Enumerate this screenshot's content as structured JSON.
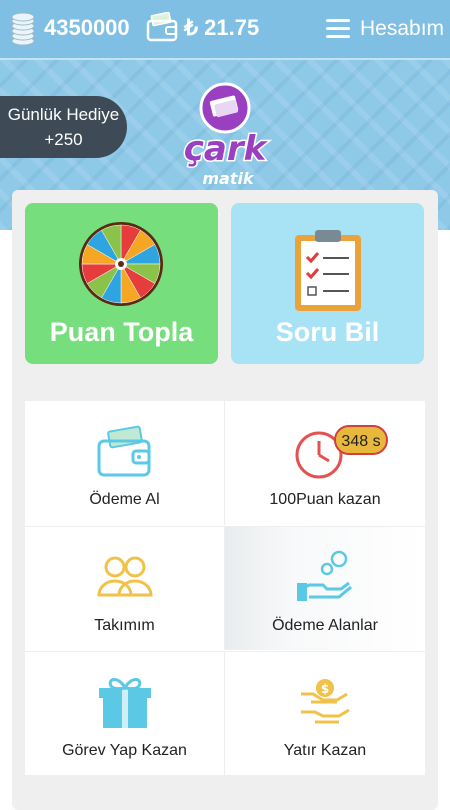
{
  "topbar": {
    "points": "4350000",
    "currency_symbol": "₺",
    "balance": "21.75",
    "menu_label": "Hesabım"
  },
  "daily_gift": {
    "label": "Günlük Hediye",
    "amount": "+250"
  },
  "logo": {
    "brand": "çark",
    "sub": "matik"
  },
  "main_tiles": [
    {
      "label": "Puan Topla",
      "icon": "prize-wheel-icon"
    },
    {
      "label": "Soru Bil",
      "icon": "checklist-clipboard-icon"
    }
  ],
  "menu_grid": [
    {
      "label": "Ödeme Al",
      "icon": "wallet-icon"
    },
    {
      "label": "100Puan kazan",
      "icon": "clock-icon",
      "badge": "348 s"
    },
    {
      "label": "Takımım",
      "icon": "team-icon"
    },
    {
      "label": "Ödeme Alanlar",
      "icon": "hand-coins-icon"
    },
    {
      "label": "Görev Yap Kazan",
      "icon": "gift-icon"
    },
    {
      "label": "Yatır Kazan",
      "icon": "deposit-money-icon"
    }
  ],
  "colors": {
    "topbar": "#7fbfe3",
    "green_tile": "#76de7c",
    "blue_tile": "#a7e3f4",
    "logo_purple": "#9b3fc1",
    "icon_blue": "#5bc9e6",
    "icon_yellow": "#f0c24a",
    "icon_red": "#e4524f"
  }
}
